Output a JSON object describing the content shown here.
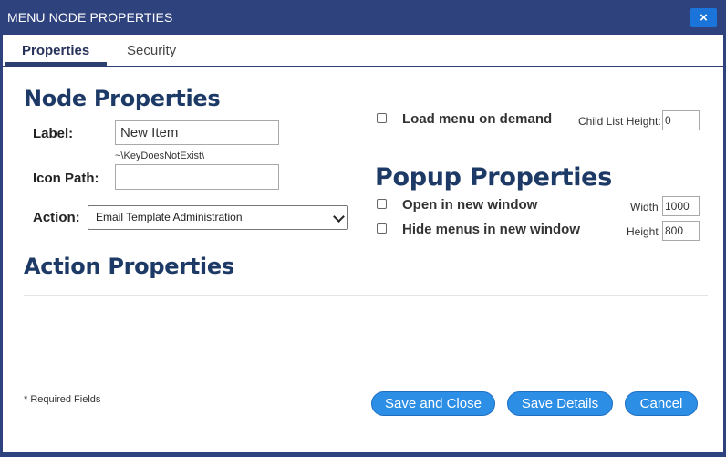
{
  "dialog": {
    "title": "MENU NODE PROPERTIES",
    "close_label": "×"
  },
  "tabs": [
    {
      "label": "Properties",
      "active": true
    },
    {
      "label": "Security",
      "active": false
    }
  ],
  "node_properties": {
    "heading": "Node Properties",
    "label_caption": "Label:",
    "label_value": "New Item",
    "icon_hint": "~\\KeyDoesNotExist\\",
    "icon_path_caption": "Icon Path:",
    "icon_path_value": "",
    "action_caption": "Action:",
    "action_selected": "Email Template Administration"
  },
  "load_on_demand": {
    "label": "Load menu on demand",
    "checked": false,
    "child_list_height_label": "Child List Height:",
    "child_list_height_value": "0"
  },
  "popup_properties": {
    "heading": "Popup Properties",
    "open_new_window_label": "Open in new window",
    "open_new_window_checked": false,
    "hide_menus_label": "Hide menus in new window",
    "hide_menus_checked": false,
    "width_label": "Width",
    "width_value": "1000",
    "height_label": "Height",
    "height_value": "800"
  },
  "action_properties": {
    "heading": "Action Properties"
  },
  "footer": {
    "required_note": "* Required Fields",
    "save_close_label": "Save and Close",
    "save_details_label": "Save Details",
    "cancel_label": "Cancel"
  },
  "colors": {
    "frame": "#2e427e",
    "heading": "#1d3a66",
    "button": "#2d8ee6",
    "close_button": "#1b74d9"
  }
}
